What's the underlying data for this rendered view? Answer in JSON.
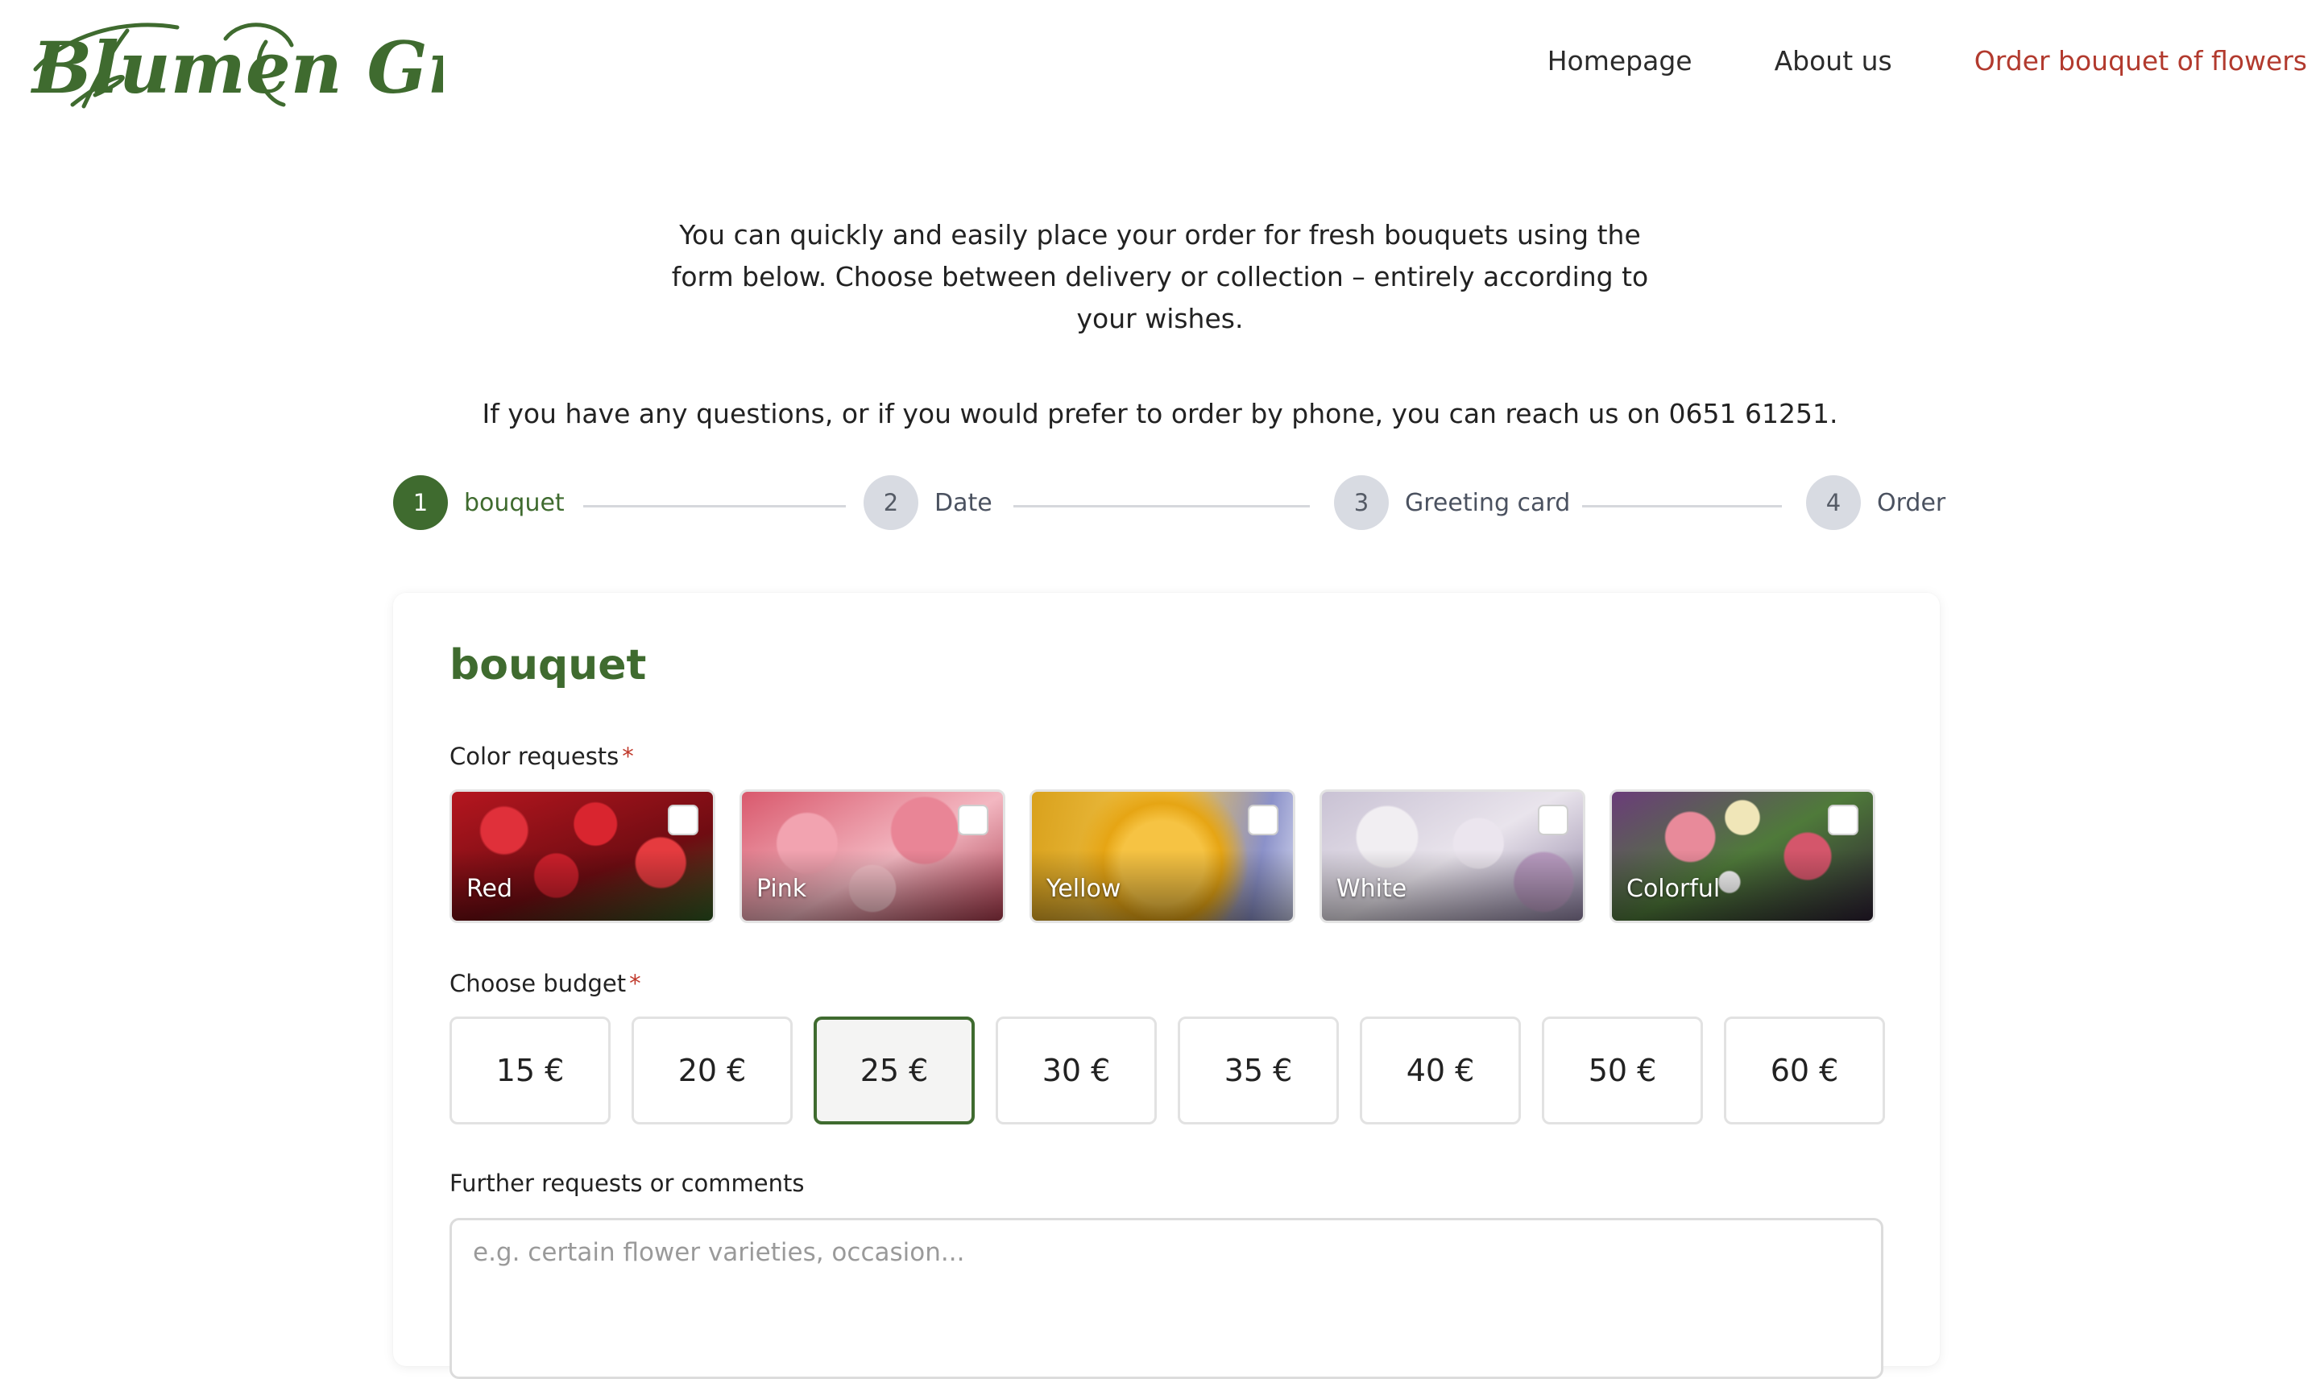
{
  "header": {
    "logo_text": "Blumen Greif",
    "nav": [
      {
        "label": "Homepage",
        "active": false
      },
      {
        "label": "About us",
        "active": false
      },
      {
        "label": "Order bouquet of flowers",
        "active": true
      }
    ]
  },
  "intro": {
    "paragraph1": "You can quickly and easily place your order for fresh bouquets using the form below. Choose between delivery or collection – entirely according to your wishes.",
    "paragraph2": "If you have any questions, or if you would prefer to order by phone, you can reach us on 0651 61251."
  },
  "stepper": {
    "current_step": 1,
    "steps": [
      {
        "number": "1",
        "label": "bouquet"
      },
      {
        "number": "2",
        "label": "Date"
      },
      {
        "number": "3",
        "label": "Greeting card"
      },
      {
        "number": "4",
        "label": "Order"
      }
    ]
  },
  "form": {
    "title": "bouquet",
    "color_label": "Color requests",
    "required_mark": "*",
    "colors": [
      {
        "name": "Red",
        "checked": false
      },
      {
        "name": "Pink",
        "checked": false
      },
      {
        "name": "Yellow",
        "checked": false
      },
      {
        "name": "White",
        "checked": false
      },
      {
        "name": "Colorful",
        "checked": false
      }
    ],
    "budget_label": "Choose budget",
    "budgets": [
      "15 €",
      "20 €",
      "25 €",
      "30 €",
      "35 €",
      "40 €",
      "50 €",
      "60 €"
    ],
    "selected_budget": "25 €",
    "comments_label": "Further requests or comments",
    "comments_placeholder": "e.g. certain flower varieties, occasion...",
    "comments_value": ""
  },
  "colors": {
    "brand_green": "#3f6b2f",
    "active_nav": "#b23a2e",
    "required": "#c0392b"
  }
}
